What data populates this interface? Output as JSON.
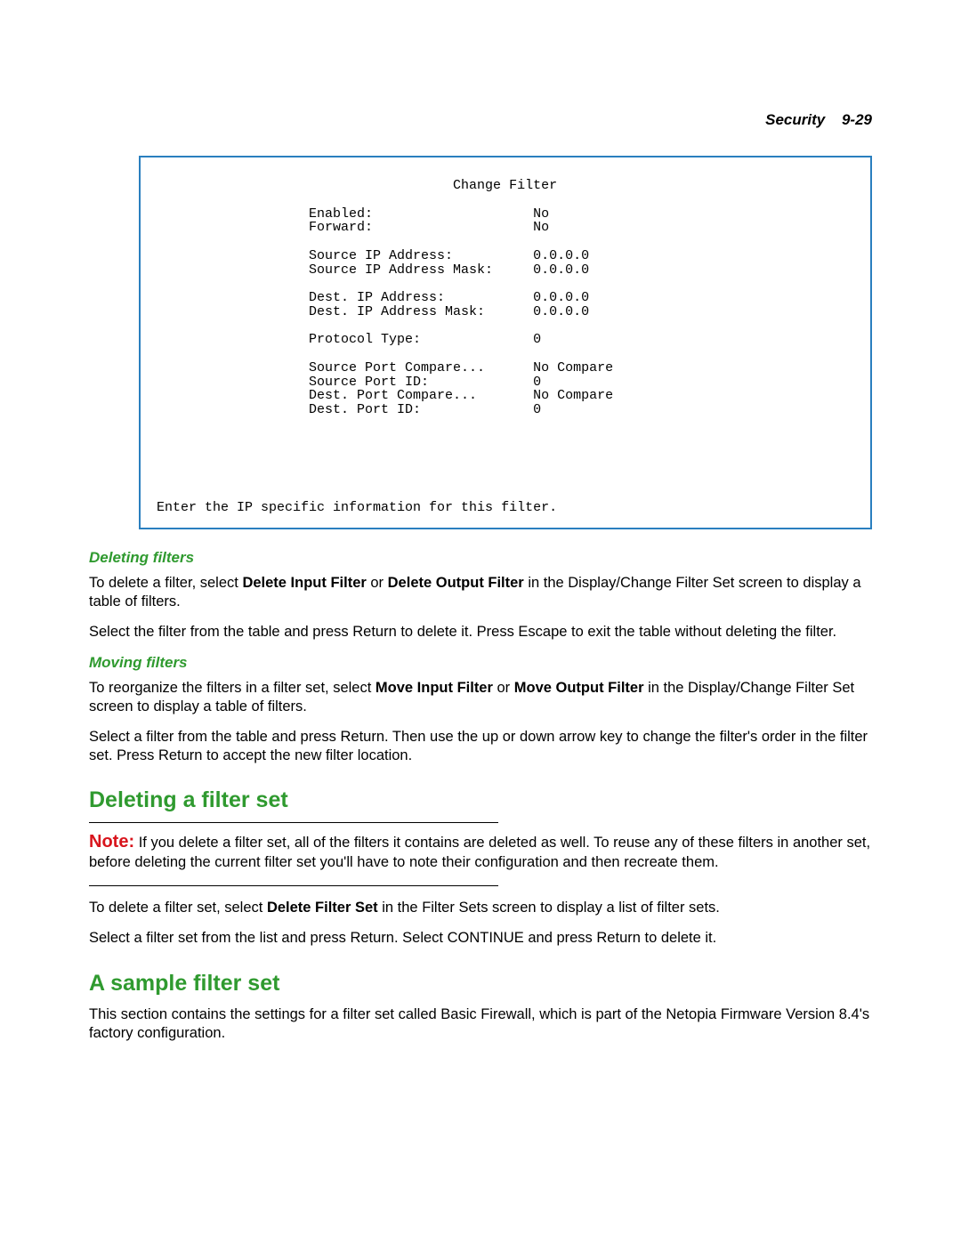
{
  "header": {
    "chapter": "Security",
    "page": "9-29"
  },
  "term": {
    "title": "Change Filter",
    "rows": [
      {
        "k": "Enabled:",
        "v": "No"
      },
      {
        "k": "Forward:",
        "v": "No"
      },
      {
        "k": "",
        "v": ""
      },
      {
        "k": "Source IP Address:",
        "v": "0.0.0.0"
      },
      {
        "k": "Source IP Address Mask:",
        "v": "0.0.0.0"
      },
      {
        "k": "",
        "v": ""
      },
      {
        "k": "Dest. IP Address:",
        "v": "0.0.0.0"
      },
      {
        "k": "Dest. IP Address Mask:",
        "v": "0.0.0.0"
      },
      {
        "k": "",
        "v": ""
      },
      {
        "k": "Protocol Type:",
        "v": "0"
      },
      {
        "k": "",
        "v": ""
      },
      {
        "k": "Source Port Compare...",
        "v": "No Compare"
      },
      {
        "k": "Source Port ID:",
        "v": "0"
      },
      {
        "k": "Dest. Port Compare...",
        "v": "No Compare"
      },
      {
        "k": "Dest. Port ID:",
        "v": "0"
      }
    ],
    "footer": "Enter the IP specific information for this filter."
  },
  "sub1": {
    "heading": "Deleting filters",
    "p1a": "To delete a filter, select ",
    "p1b": "Delete Input Filter",
    "p1c": " or ",
    "p1d": "Delete Output Filter",
    "p1e": " in the Display/Change Filter Set screen to display a table of filters.",
    "p2": "Select the filter from the table and press Return to delete it. Press Escape to exit the table without deleting the filter."
  },
  "sub2": {
    "heading": "Moving filters",
    "p1a": "To reorganize the filters in a filter set, select ",
    "p1b": "Move Input Filter",
    "p1c": " or ",
    "p1d": "Move Output Filter",
    "p1e": " in the Display/Change Filter Set screen to display a table of filters.",
    "p2": "Select a filter from the table and press Return. Then use the up or down arrow key to change the filter's order in the filter set. Press Return to accept the new filter location."
  },
  "sec1": {
    "heading": "Deleting a filter set",
    "note_label": "Note:",
    "note_body": "  If you delete a filter set, all of the filters it contains are deleted as well. To reuse any of these filters in another set, before deleting the current filter set you'll have to note their configuration and then recreate them.",
    "p1a": "To delete a filter set, select ",
    "p1b": "Delete Filter Set",
    "p1c": " in the Filter Sets screen to display a list of filter sets.",
    "p2": "Select a filter set from the list and press Return. Select CONTINUE and press Return to delete it."
  },
  "sec2": {
    "heading": "A sample filter set",
    "p1": "This section contains the settings for a filter set called Basic Firewall, which is part of the Netopia Firmware Version 8.4's factory configuration."
  }
}
